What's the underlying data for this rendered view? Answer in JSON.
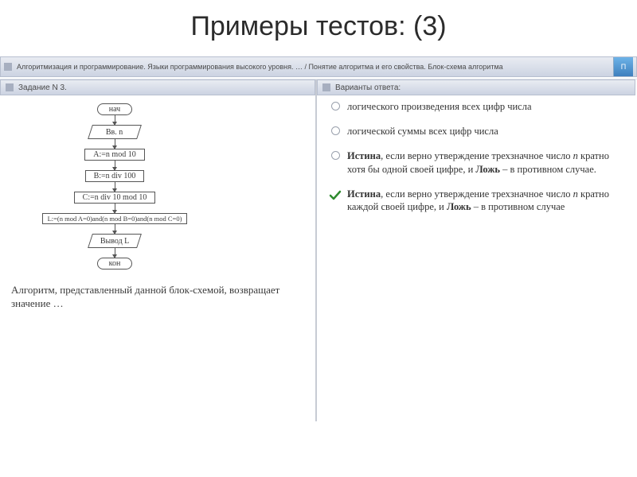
{
  "title": "Примеры тестов: (3)",
  "breadcrumb": "Алгоритмизация и программирование. Языки программирования высокого уровня. … / Понятие алгоритма и его свойства. Блок-схема алгоритма",
  "breadcrumb_btn": "П",
  "panels": {
    "left_head": "Задание N 3.",
    "right_head": "Варианты ответа:"
  },
  "flowchart": {
    "start": "нач",
    "input": "Вв. n",
    "s1": "A:=n mod 10",
    "s2": "B:=n div 100",
    "s3": "C:=n div 10 mod 10",
    "s4": "L:=(n mod A=0)and(n mod B=0)and(n mod C=0)",
    "output": "Вывод L",
    "end": "кон"
  },
  "question_footer": "Алгоритм, представленный данной блок-схемой, возвращает значение …",
  "answers": [
    {
      "selected": false,
      "text": "логического произведения всех цифр числа"
    },
    {
      "selected": false,
      "text": "логической суммы всех цифр числа"
    },
    {
      "selected": false,
      "html": "<b>Истина</b>, если верно утверждение трехзначное число <i>n</i> кратно хотя бы одной своей цифре, и <b>Ложь</b> – в противном случае."
    },
    {
      "selected": true,
      "html": "<b>Истина</b>, если верно утверждение трехзначное число <i>n</i> кратно каждой своей цифре, и <b>Ложь</b> – в противном случае"
    }
  ]
}
